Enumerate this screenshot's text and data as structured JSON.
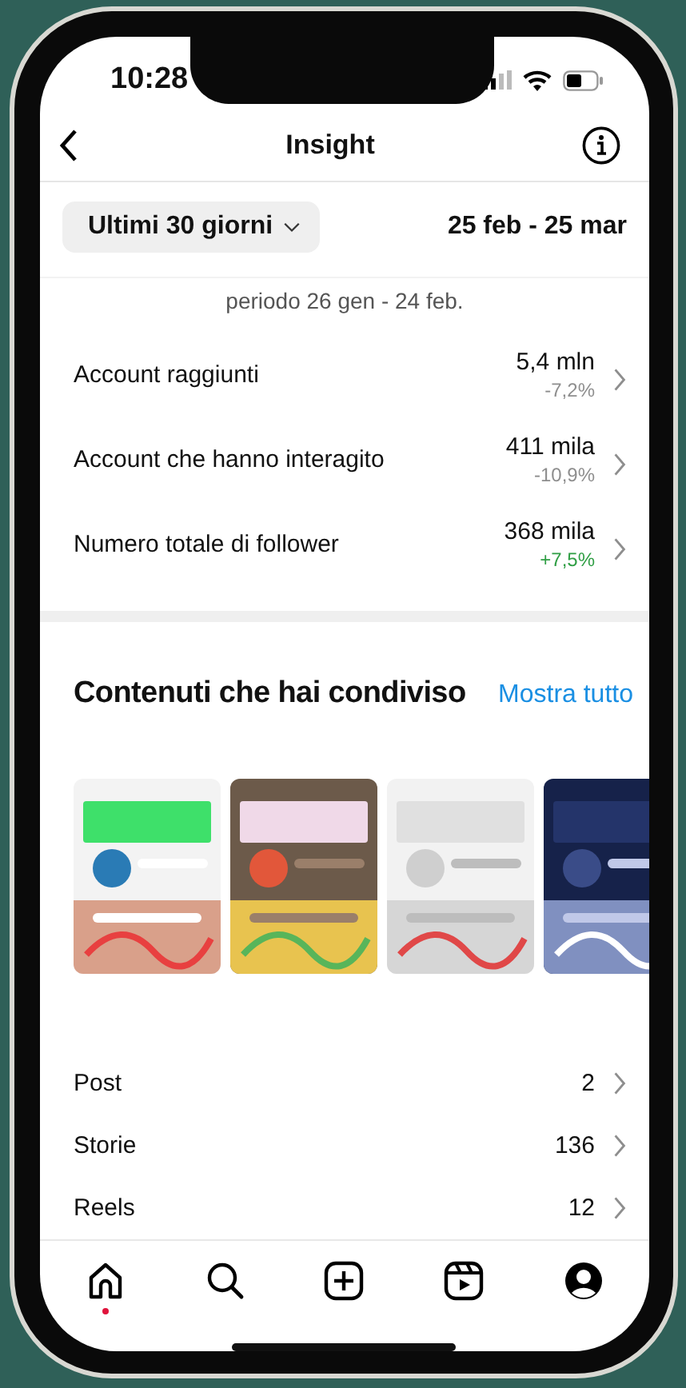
{
  "status_bar": {
    "time": "10:28"
  },
  "header": {
    "title": "Insight"
  },
  "filter": {
    "label": "Ultimi 30 giorni",
    "range": "25 feb - 25 mar"
  },
  "summary": "periodo 26 gen - 24 feb.",
  "metrics": [
    {
      "label": "Account raggiunti",
      "value": "5,4 mln",
      "change": "-7,2%",
      "color": "#8e8e8e"
    },
    {
      "label": "Account che hanno interagito",
      "value": "411 mila",
      "change": "-10,9%",
      "color": "#8e8e8e"
    },
    {
      "label": "Numero totale di follower",
      "value": "368 mila",
      "change": "+7,5%",
      "color": "#2f9e44"
    }
  ],
  "shared": {
    "title": "Contenuti che hai condiviso",
    "link": "Mostra tutto"
  },
  "counts": [
    {
      "label": "Post",
      "value": "2"
    },
    {
      "label": "Storie",
      "value": "136"
    },
    {
      "label": "Reels",
      "value": "12"
    }
  ],
  "tab_bar": [
    {
      "kind": "home",
      "dot": true
    },
    {
      "kind": "search",
      "dot": false
    },
    {
      "kind": "add",
      "dot": false
    },
    {
      "kind": "reels",
      "dot": false
    },
    {
      "kind": "profile",
      "dot": false
    }
  ]
}
